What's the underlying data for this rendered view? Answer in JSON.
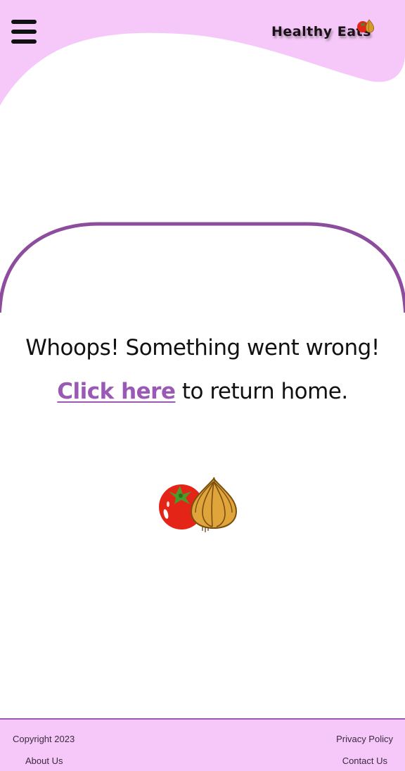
{
  "header": {
    "brand_name": "Healthy Eats",
    "menu_icon": "hamburger-menu-icon",
    "logo_icon": "tomato-onion-logo-icon",
    "background_color": "#f6c8f9"
  },
  "main": {
    "headline": "Whoops! Something went wrong!",
    "link_text": "Click here",
    "return_text": " to return home.",
    "illustration_icon": "tomato-onion-icon",
    "link_color": "#9b59b6",
    "arch_color": "#8e4c9e"
  },
  "footer": {
    "copyright": "Copyright 2023",
    "about": "About Us",
    "privacy": "Privacy Policy",
    "contact": "Contact Us",
    "background_color": "#f6c8f9",
    "border_color": "#9b59b6"
  }
}
